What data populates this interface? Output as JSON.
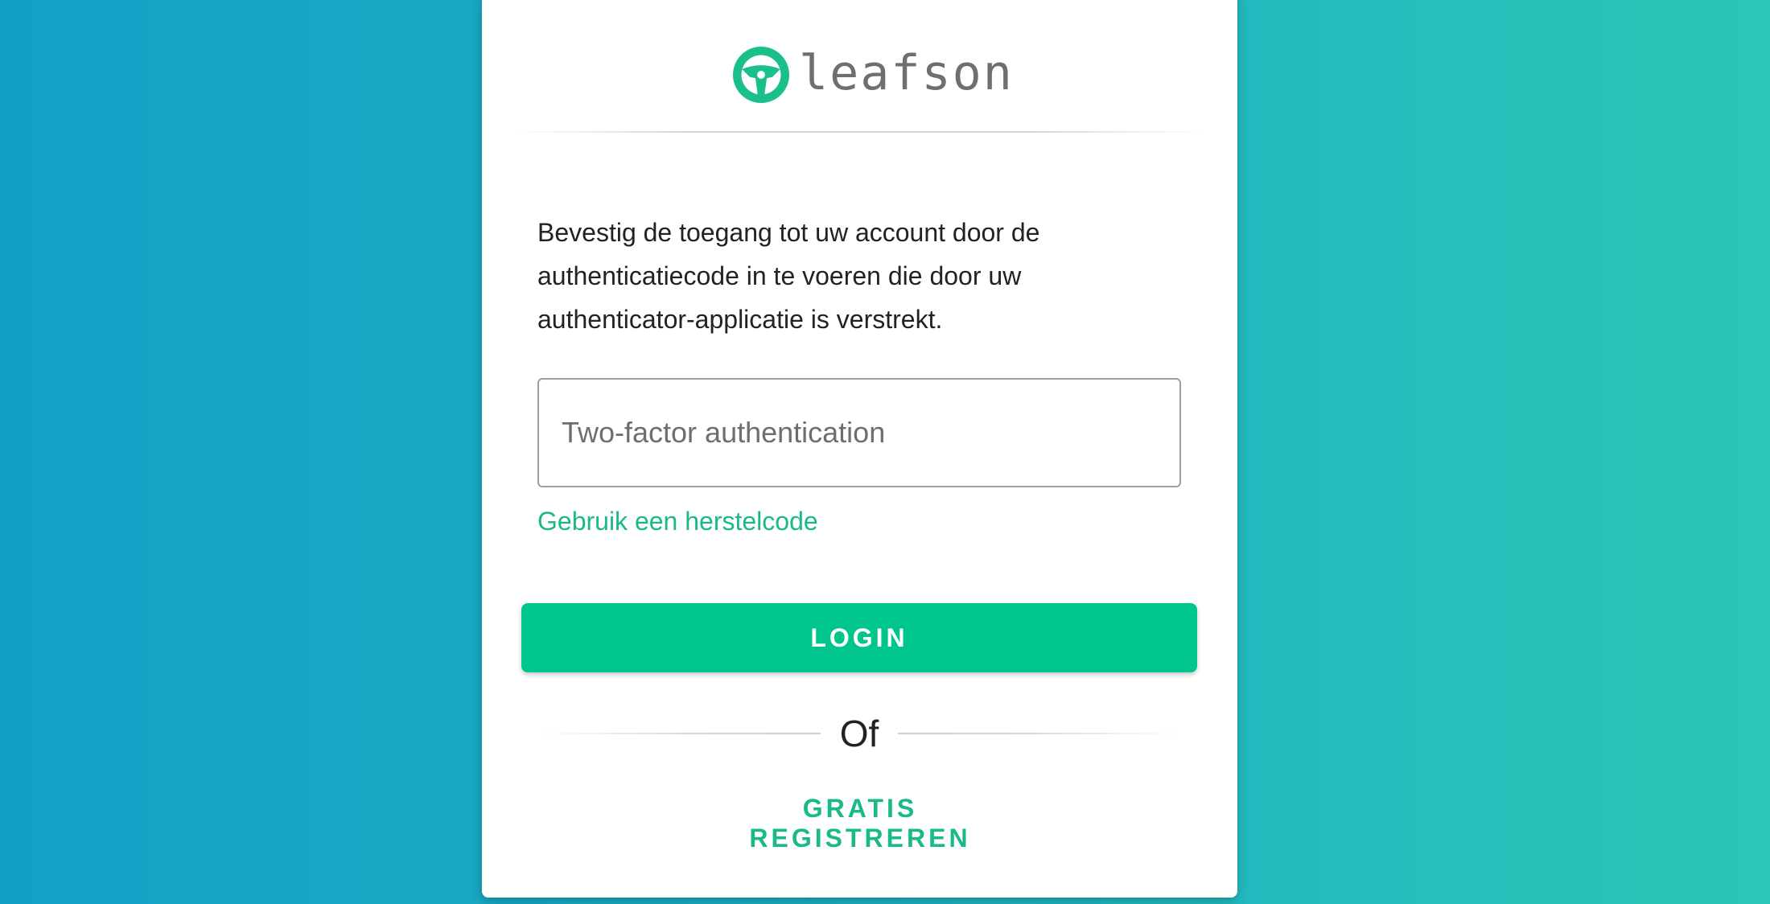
{
  "brand": {
    "name": "leafson",
    "accent_color": "#00c58c",
    "logo_icon": "steering-wheel-icon"
  },
  "form": {
    "instructions": "Bevestig de toegang tot uw account door de authenticatiecode in te voeren die door uw authenticator-applicatie is verstrekt.",
    "code_field": {
      "placeholder": "Two-factor authentication",
      "value": ""
    },
    "recovery_link": "Gebruik een herstelcode",
    "login_label": "LOGIN",
    "separator_text": "Of",
    "register_label": "GRATIS REGISTREREN"
  }
}
